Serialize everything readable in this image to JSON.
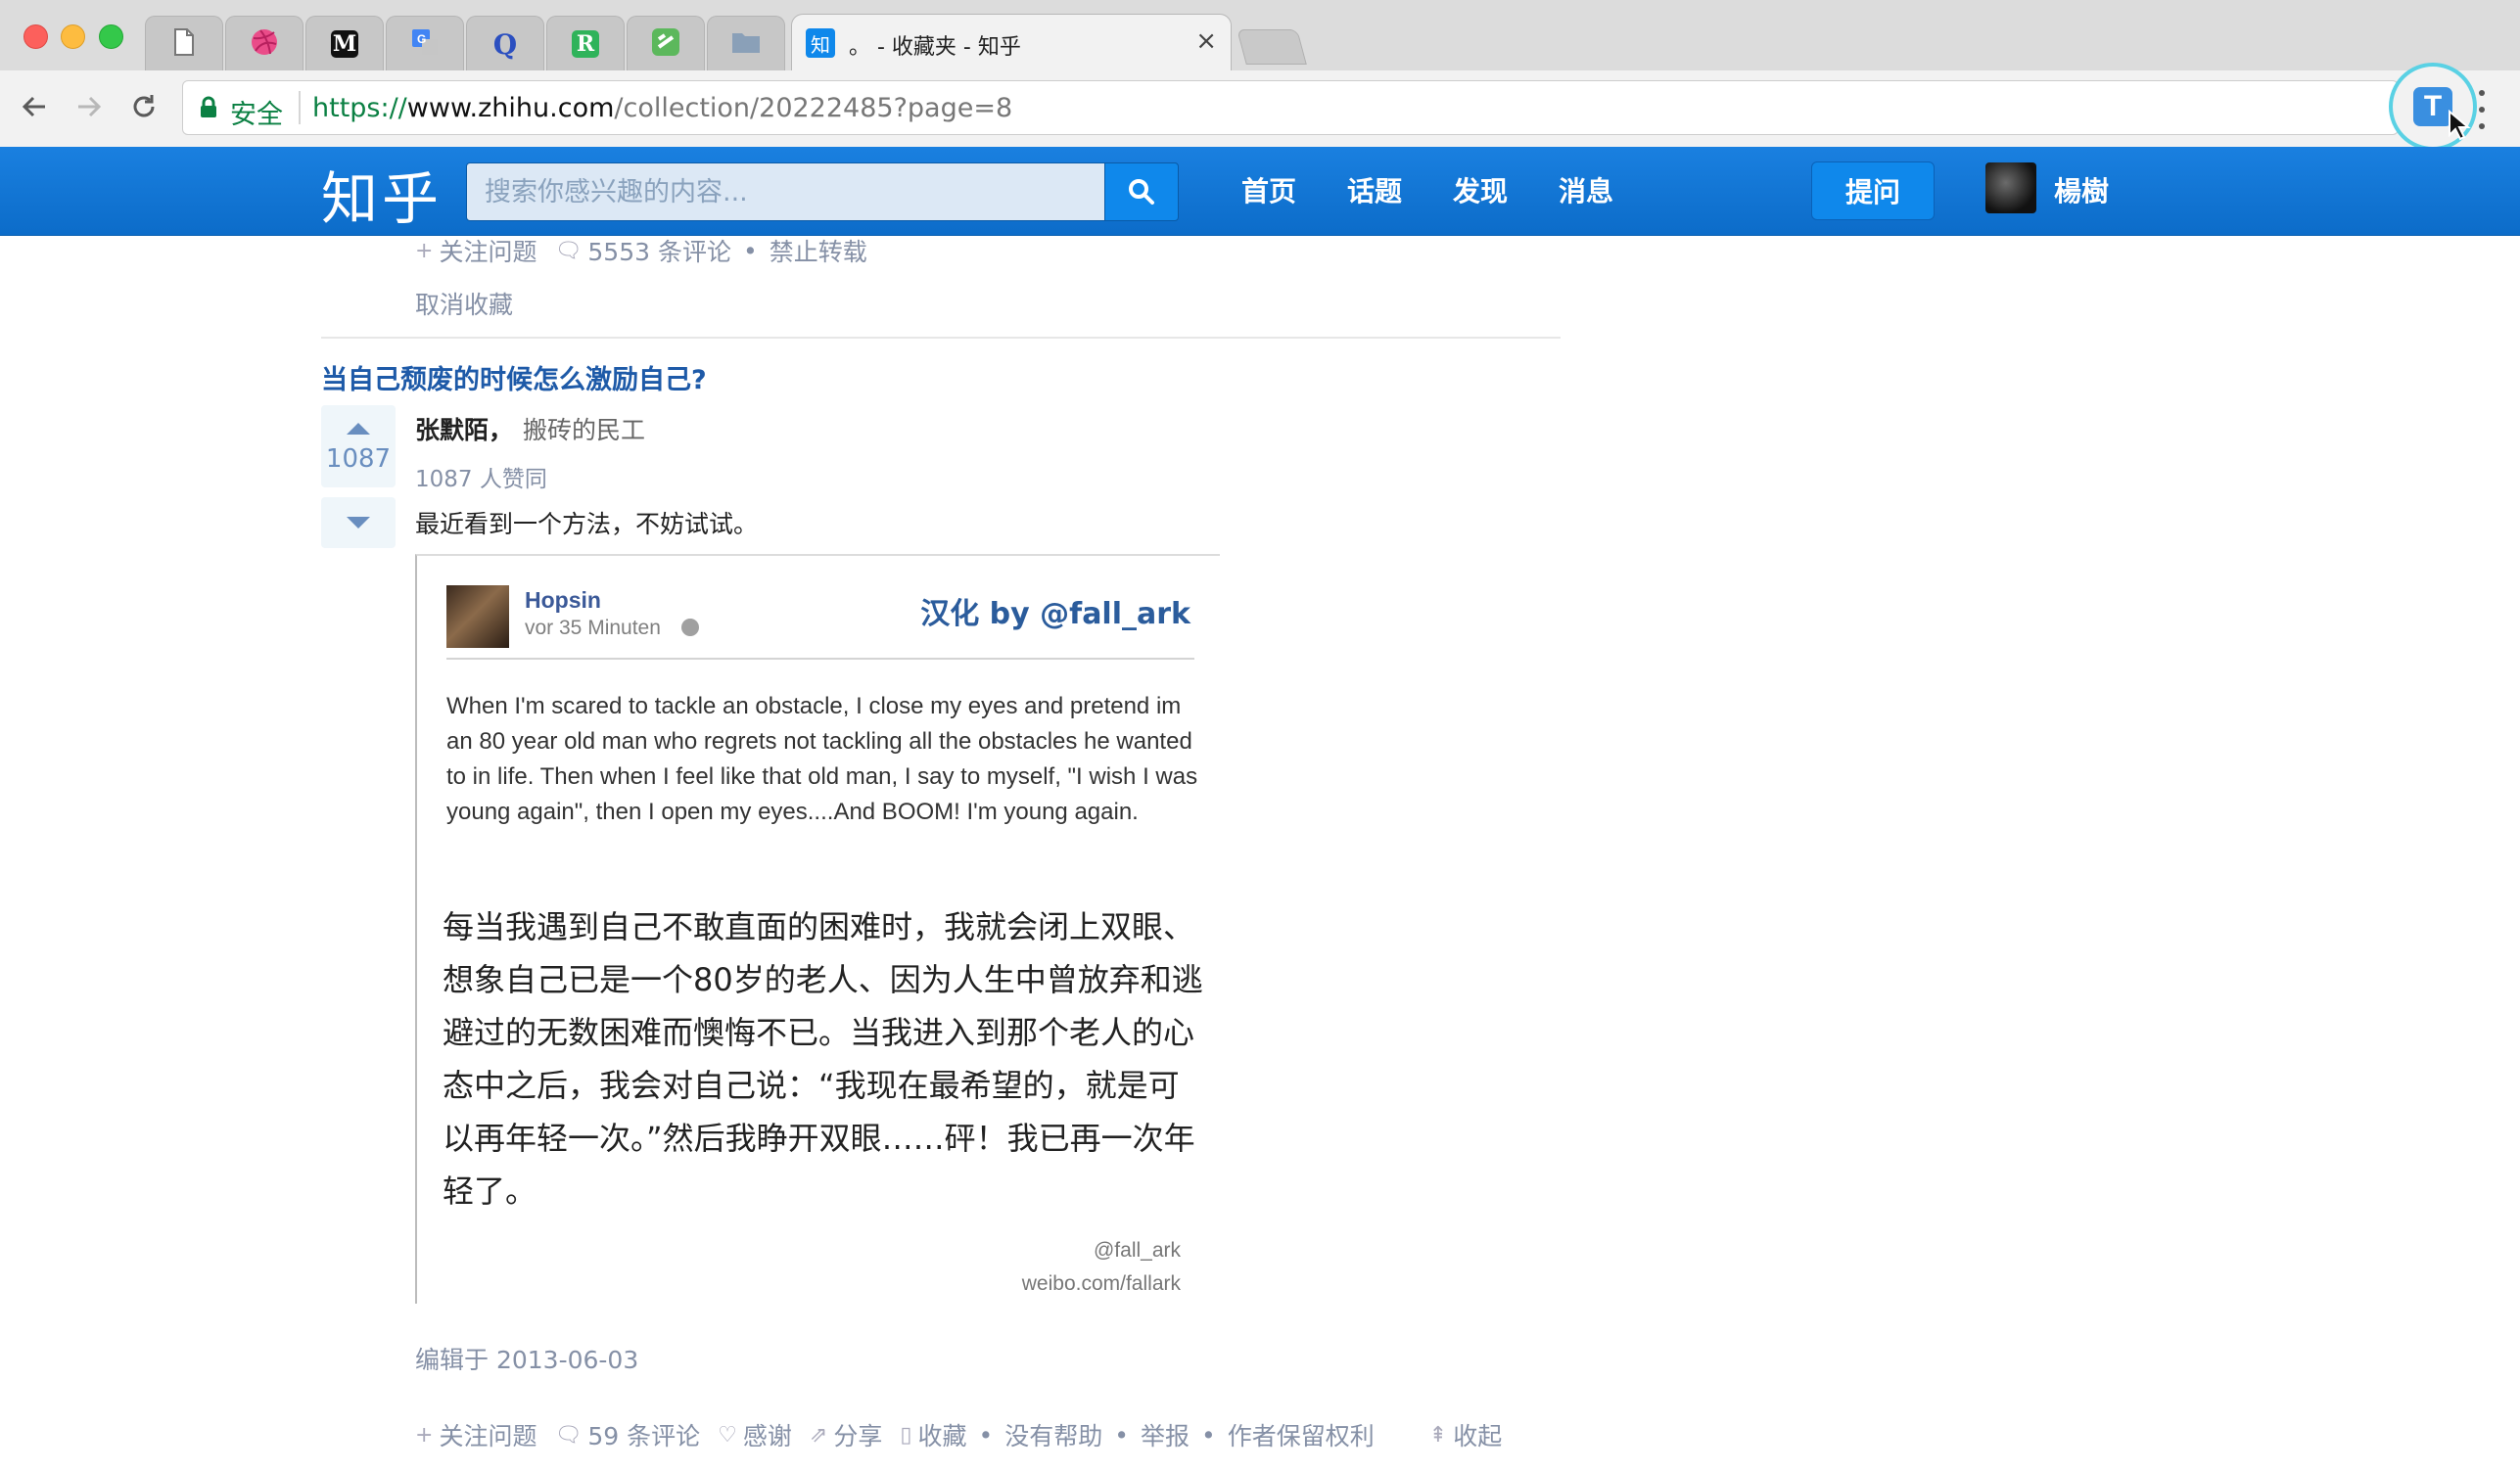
{
  "browser": {
    "active_tab": {
      "favicon": "知",
      "title": "。 - 收藏夹 - 知乎",
      "close": "×"
    },
    "tabs": [
      {
        "icon": "document-icon",
        "glyph": ""
      },
      {
        "icon": "dribbble-icon",
        "glyph": ""
      },
      {
        "icon": "medium-icon",
        "glyph": "M"
      },
      {
        "icon": "translate-icon",
        "glyph": ""
      },
      {
        "icon": "quora-icon",
        "glyph": "Q"
      },
      {
        "icon": "r-icon",
        "glyph": "R"
      },
      {
        "icon": "green-s-icon",
        "glyph": ""
      },
      {
        "icon": "folder-icon",
        "glyph": ""
      }
    ],
    "secure_label": "安全",
    "url": {
      "scheme": "https://",
      "host": "www.zhihu.com",
      "path": "/collection/20222485?page=8"
    },
    "extension": {
      "letter": "T"
    }
  },
  "header": {
    "logo": "知乎",
    "search_placeholder": "搜索你感兴趣的内容...",
    "nav": [
      "首页",
      "话题",
      "发现",
      "消息"
    ],
    "ask_label": "提问",
    "username": "楊樹"
  },
  "prev_item": {
    "follow": "关注问题",
    "comments": "5553 条评论",
    "no_repost": "禁止转载",
    "cancel_fav": "取消收藏"
  },
  "item": {
    "question": "当自己颓废的时候怎么激励自己?",
    "vote_count": "1087",
    "author": "张默陌，",
    "author_bio": "搬砖的民工",
    "vote_info": "1087 人赞同",
    "answer_text": "最近看到一个方法，不妨试试。",
    "image": {
      "fb_name": "Hopsin",
      "fb_time": "vor 35 Minuten",
      "credit": "汉化 by @fall_ark",
      "en_text": "When I'm scared to tackle an obstacle, I close my eyes and pretend im an 80 year old man who regrets not tackling all the obstacles he wanted to in life. Then when I feel like that old man, I say to myself, \"I wish I was young again\", then I open my eyes....And BOOM! I'm young again.",
      "zh_text": "每当我遇到自己不敢直面的困难时，我就会闭上双眼、想象自己已是一个80岁的老人、因为人生中曾放弃和逃避过的无数困难而懊悔不已。当我进入到那个老人的心态中之后，我会对自己说：“我现在最希望的，就是可以再年轻一次。”然后我睁开双眼……砰！我已再一次年轻了。",
      "watermark_1": "@fall_ark",
      "watermark_2": "weibo.com/fallark"
    },
    "edited": "编辑于 2013-06-03",
    "actions": {
      "follow": "关注问题",
      "comments": "59 条评论",
      "thanks": "感谢",
      "share": "分享",
      "collect": "收藏",
      "no_help": "没有帮助",
      "report": "举报",
      "rights": "作者保留权利",
      "collapse": "收起"
    }
  },
  "colors": {
    "zhihu_blue": "#0f88eb",
    "link_blue": "#1e5aa8",
    "meta_gray": "#8590a6",
    "secure_green": "#0b8043"
  }
}
